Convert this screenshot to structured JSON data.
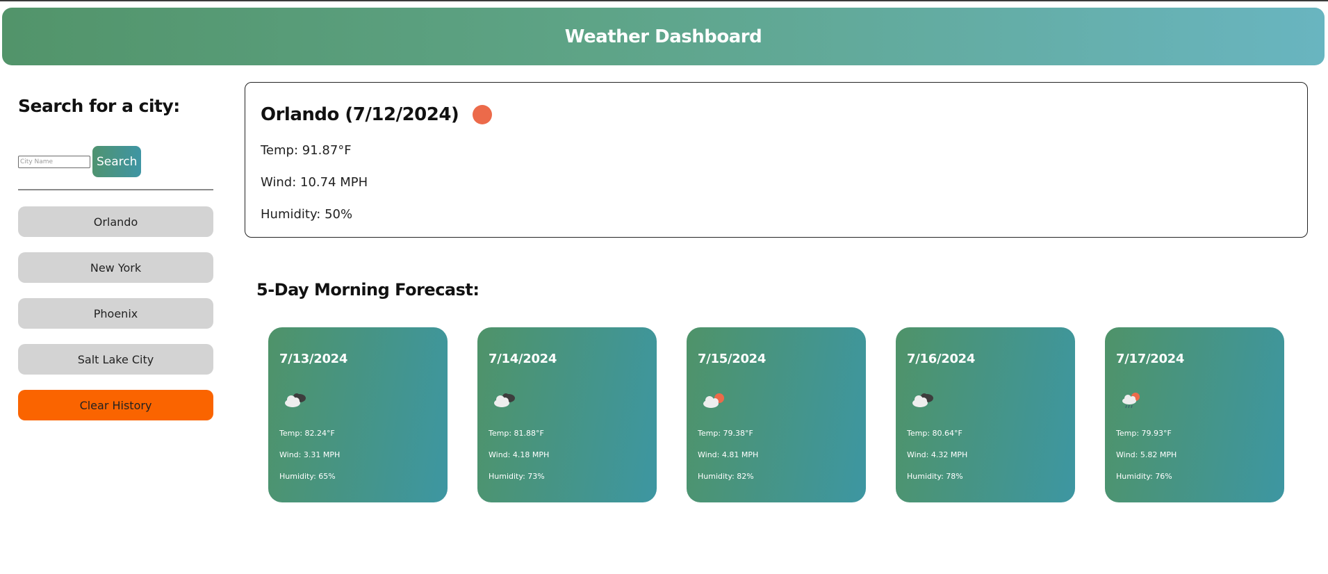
{
  "header": {
    "title": "Weather Dashboard"
  },
  "sidebar": {
    "heading": "Search for a city:",
    "search_placeholder": "City Name",
    "search_label": "Search",
    "history": [
      {
        "label": "Orlando"
      },
      {
        "label": "New York"
      },
      {
        "label": "Phoenix"
      },
      {
        "label": "Salt Lake City"
      }
    ],
    "clear_label": "Clear History"
  },
  "current": {
    "title": "Orlando (7/12/2024)",
    "icon": "clear-sun-icon",
    "temp": "Temp: 91.87°F",
    "wind": "Wind: 10.74 MPH",
    "humidity": "Humidity: 50%"
  },
  "forecast": {
    "heading": "5-Day Morning Forecast:",
    "days": [
      {
        "date": "7/13/2024",
        "icon": "overcast-clouds-icon",
        "temp": "Temp: 82.24°F",
        "wind": "Wind: 3.31 MPH",
        "humidity": "Humidity: 65%"
      },
      {
        "date": "7/14/2024",
        "icon": "overcast-clouds-icon",
        "temp": "Temp: 81.88°F",
        "wind": "Wind: 4.18 MPH",
        "humidity": "Humidity: 73%"
      },
      {
        "date": "7/15/2024",
        "icon": "partly-cloudy-icon",
        "temp": "Temp: 79.38°F",
        "wind": "Wind: 4.81 MPH",
        "humidity": "Humidity: 82%"
      },
      {
        "date": "7/16/2024",
        "icon": "overcast-clouds-icon",
        "temp": "Temp: 80.64°F",
        "wind": "Wind: 4.32 MPH",
        "humidity": "Humidity: 78%"
      },
      {
        "date": "7/17/2024",
        "icon": "rain-sun-icon",
        "temp": "Temp: 79.93°F",
        "wind": "Wind: 5.82 MPH",
        "humidity": "Humidity: 76%"
      }
    ]
  },
  "colors": {
    "header_start": "#52946a",
    "header_end": "#69b5c0",
    "card_start": "#4f9369",
    "card_end": "#3d96a2",
    "clear_button": "#fa6400",
    "history_button": "#d3d3d3",
    "sun": "#ec6a4a"
  }
}
